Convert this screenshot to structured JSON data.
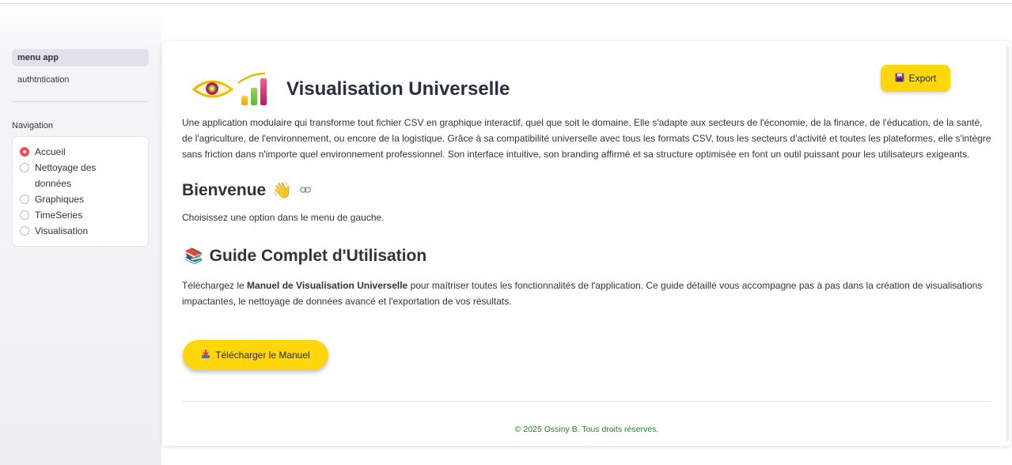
{
  "sidebar": {
    "pages": [
      {
        "label": "menu app",
        "active": true
      },
      {
        "label": "authtntication",
        "active": false
      }
    ],
    "navigation_title": "Navigation",
    "radio_options": [
      "Accueil",
      "Nettoyage des données",
      "Graphiques",
      "TimeSeries",
      "Visualisation"
    ],
    "selected_option": "Accueil"
  },
  "header": {
    "title": "Visualisation Universelle",
    "export_label": "Export",
    "export_icon": "floppy-disk-icon"
  },
  "main": {
    "intro": "Une application modulaire qui transforme tout fichier CSV en graphique interactif, quel que soit le domaine. Elle s'adapte aux secteurs de l'économie, de la finance, de l'éducation, de la santé, de l'agriculture, de l'environnement, ou encore de la logistique. Grâce à sa compatibilité universelle avec tous les formats CSV, tous les secteurs d'activité et toutes les plateformes, elle s'intègre sans friction dans n'importe quel environnement professionnel. Son interface intuitive, son branding affirmé et sa structure optimisée en font un outil puissant pour les utilisateurs exigeants.",
    "welcome_heading": "Bienvenue",
    "welcome_emoji": "👋",
    "choose_text": "Choisissez une option dans le menu de gauche.",
    "guide_heading": "Guide Complet d'Utilisation",
    "guide_emoji": "📚",
    "guide_text_before": "Téléchargez le ",
    "guide_text_bold": "Manuel de Visualisation Universelle",
    "guide_text_after": " pour maîtriser toutes les fonctionnalités de l'application. Ce guide détaillé vous accompagne pas à pas dans la création de visualisations impactantes, le nettoyage de données avancé et l'exportation de vos résultats.",
    "download_label": "Télécharger le Manuel",
    "download_icon": "download-tray-icon"
  },
  "footer": {
    "text": "© 2025 Ossiny B. Tous droits réservés."
  },
  "colors": {
    "accent_yellow": "#ffd60a",
    "radio_selected": "#ff4b4b",
    "footer_green": "#1a8a1a",
    "title_navy": "#262f45"
  }
}
